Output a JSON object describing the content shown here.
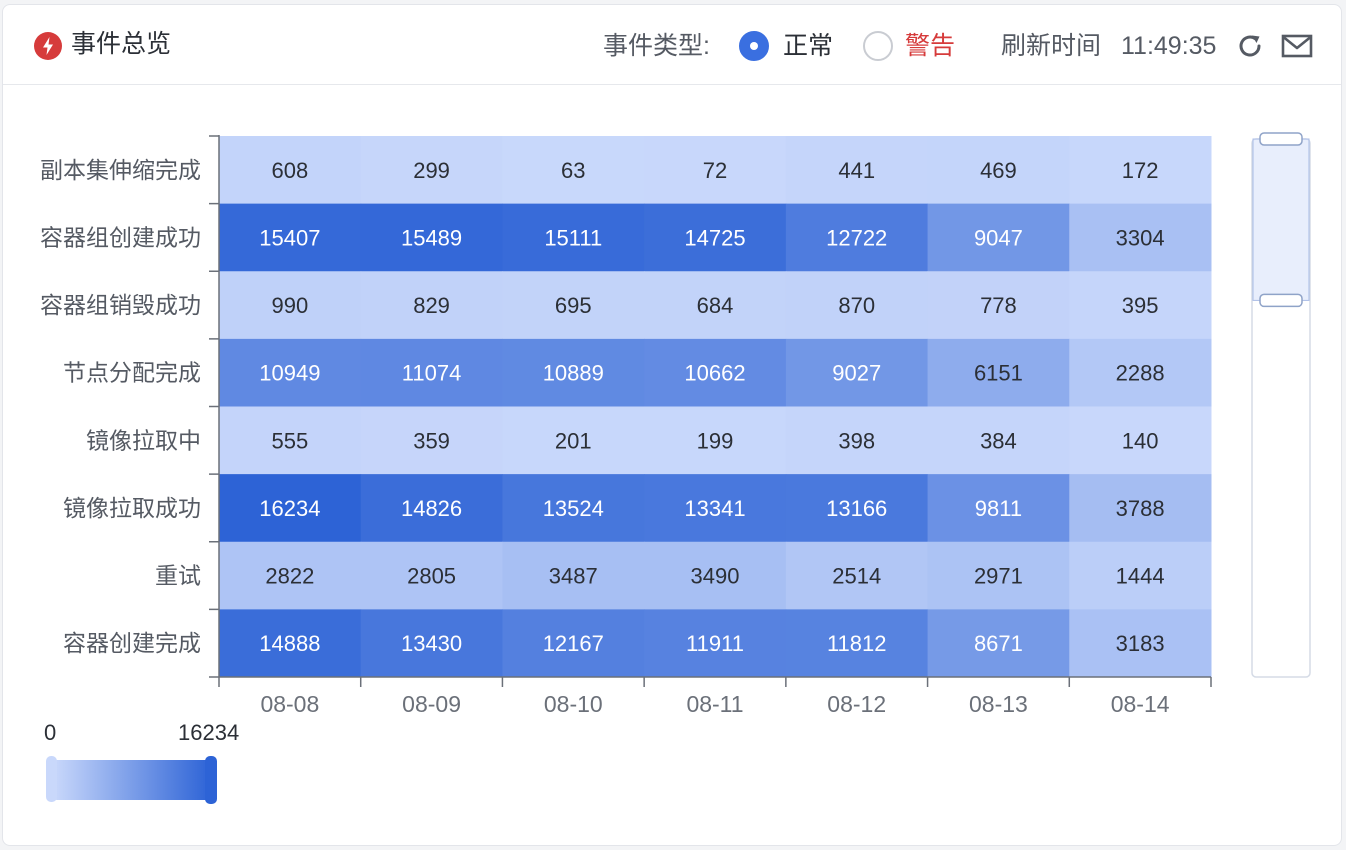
{
  "header": {
    "title": "事件总览",
    "type_label": "事件类型:",
    "options": {
      "normal": "正常",
      "warning": "警告"
    },
    "selected_option": "正常",
    "refresh_label": "刷新时间",
    "refresh_time": "11:49:35",
    "icons": {
      "title": "flash-icon",
      "refresh": "refresh-icon",
      "mail": "mail-icon"
    },
    "colors": {
      "accent": "#3a6fe0",
      "warning": "#d63b3b"
    }
  },
  "chart_data": {
    "type": "heatmap",
    "x_categories": [
      "08-08",
      "08-09",
      "08-10",
      "08-11",
      "08-12",
      "08-13",
      "08-14"
    ],
    "y_categories": [
      "副本集伸缩完成",
      "容器组创建成功",
      "容器组销毁成功",
      "节点分配完成",
      "镜像拉取中",
      "镜像拉取成功",
      "重试",
      "容器创建完成"
    ],
    "values": [
      [
        608,
        299,
        63,
        72,
        441,
        469,
        172
      ],
      [
        15407,
        15489,
        15111,
        14725,
        12722,
        9047,
        3304
      ],
      [
        990,
        829,
        695,
        684,
        870,
        778,
        395
      ],
      [
        10949,
        11074,
        10889,
        10662,
        9027,
        6151,
        2288
      ],
      [
        555,
        359,
        201,
        199,
        398,
        384,
        140
      ],
      [
        16234,
        14826,
        13524,
        13341,
        13166,
        9811,
        3788
      ],
      [
        2822,
        2805,
        3487,
        3490,
        2514,
        2971,
        1444
      ],
      [
        14888,
        13430,
        12167,
        11911,
        11812,
        8671,
        3183
      ]
    ],
    "visual_map": {
      "min": 0,
      "max": 16234,
      "min_label": "0",
      "max_label": "16234",
      "low_color": "#c9d8fb",
      "high_color": "#2d63d6"
    },
    "data_zoom": {
      "orientation": "vertical",
      "start": 0,
      "end": 0.3
    },
    "grid": false,
    "legend": "bottom-left"
  }
}
